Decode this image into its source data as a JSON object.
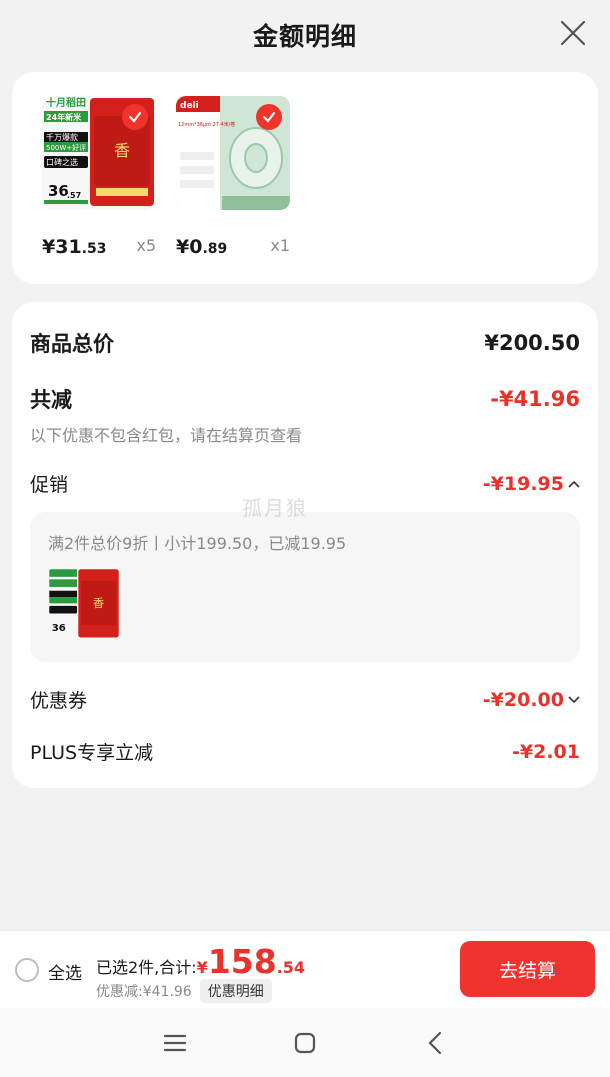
{
  "header": {
    "title": "金额明细"
  },
  "products": [
    {
      "price_int": "¥31",
      "price_dec": ".53",
      "qty": "x5"
    },
    {
      "price_int": "¥0",
      "price_dec": ".89",
      "qty": "x1"
    }
  ],
  "product_art": {
    "rice_brand": "十月稻田",
    "rice_new": "24年新米",
    "rice_sold": "千万爆款",
    "rice_reviews": "500W+好评",
    "rice_tag": "口碑之选",
    "rice_price": "36",
    "rice_price_dec": ".57",
    "tape_brand": "deli",
    "tape_spec": "12mm*36μm 27.4米/卷"
  },
  "details": {
    "total_label": "商品总价",
    "total_value": "¥200.50",
    "reduce_label": "共减",
    "reduce_value": "-¥41.96",
    "note": "以下优惠不包含红包，请在结算页查看",
    "promo_label": "促销",
    "promo_value": "-¥19.95",
    "promo_detail": "满2件总价9折丨小计199.50，已减19.95",
    "coupon_label": "优惠券",
    "coupon_value": "-¥20.00",
    "plus_label": "PLUS专享立减",
    "plus_value": "-¥2.01"
  },
  "watermark": "孤月狼",
  "bottom": {
    "select_all": "全选",
    "selected_summary": "已选2件,合计:",
    "total_yen": "¥",
    "total_int": "158",
    "total_dec": ".54",
    "discount": "优惠减:¥41.96",
    "detail_btn": "优惠明细",
    "checkout": "去结算"
  },
  "colors": {
    "accent": "#f0342d",
    "price_red": "#e8322b",
    "muted": "#8a8a8a"
  }
}
